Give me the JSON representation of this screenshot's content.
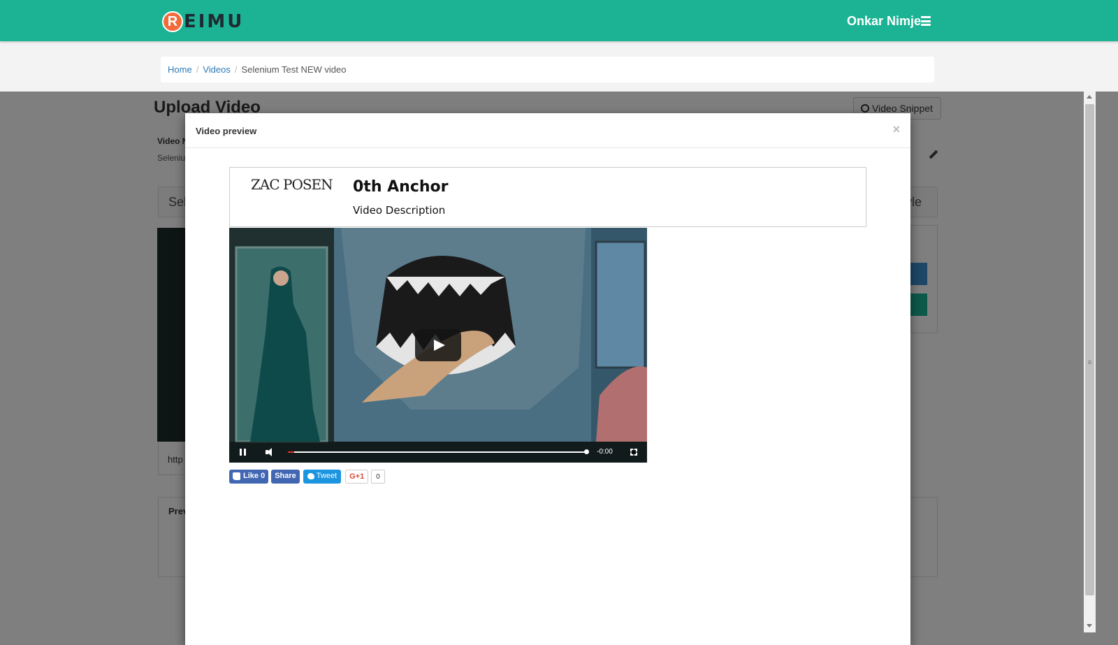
{
  "header": {
    "logo_text": "EIMU",
    "logo_letter": "R",
    "user_name": "Onkar Nimje"
  },
  "breadcrumb": {
    "home": "Home",
    "videos": "Videos",
    "current": "Selenium Test NEW video"
  },
  "page": {
    "title": "Upload Video",
    "snippet_button": "Video Snippet",
    "video_label": "Video N",
    "video_value": "Seleniu",
    "select_text": "Sel",
    "style_text": "yle",
    "url_text": "http",
    "preview_label": "Prev"
  },
  "modal": {
    "title": "Video preview",
    "close": "×",
    "brand": "ZAC POSEN",
    "anchor_title": "0th Anchor",
    "anchor_description": "Video Description",
    "player": {
      "time": "-0:00",
      "progress_fraction": 0.02
    },
    "social": {
      "like": "Like 0",
      "share": "Share",
      "tweet": "Tweet",
      "gplus": "G+1",
      "gplus_count": "0"
    }
  },
  "colors": {
    "brand_teal": "#1bb394",
    "link_blue": "#2c7ab8",
    "facebook": "#4267b2",
    "twitter": "#1b95e0",
    "logo_orange": "#f26b3a"
  }
}
